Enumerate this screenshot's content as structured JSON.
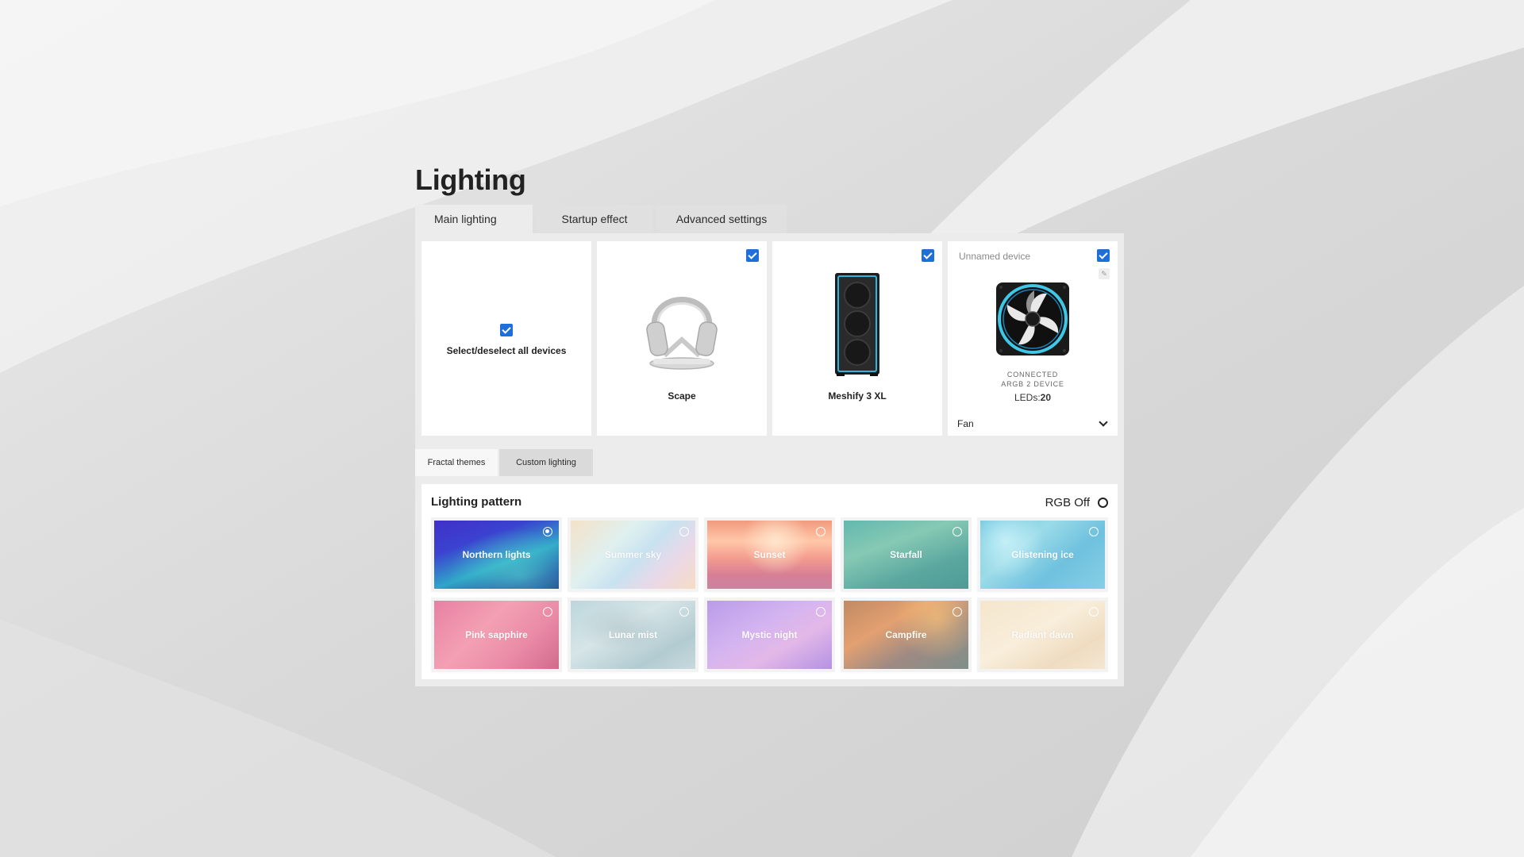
{
  "page": {
    "title": "Lighting"
  },
  "main_tabs": [
    {
      "label": "Main lighting",
      "active": true
    },
    {
      "label": "Startup effect",
      "active": false
    },
    {
      "label": "Advanced settings",
      "active": false
    }
  ],
  "devices": {
    "select_all": {
      "label": "Select/deselect all devices",
      "checked": true
    },
    "items": [
      {
        "name": "Scape",
        "checked": true,
        "icon": "headset-icon"
      },
      {
        "name": "Meshify 3 XL",
        "checked": true,
        "icon": "pc-case-icon"
      },
      {
        "name": "Unnamed device",
        "checked": true,
        "icon": "fan-icon",
        "connected_line1": "Connected",
        "connected_line2": "ARGB 2 device",
        "leds_label": "LEDs:",
        "leds_count": "20",
        "type_value": "Fan"
      }
    ]
  },
  "sub_tabs": [
    {
      "label": "Fractal themes",
      "active": true
    },
    {
      "label": "Custom lighting",
      "active": false
    }
  ],
  "pattern": {
    "title": "Lighting pattern",
    "rgb_off_label": "RGB Off",
    "themes": [
      {
        "label": "Northern lights",
        "selected": true
      },
      {
        "label": "Summer sky",
        "selected": false
      },
      {
        "label": "Sunset",
        "selected": false
      },
      {
        "label": "Starfall",
        "selected": false
      },
      {
        "label": "Glistening ice",
        "selected": false
      },
      {
        "label": "Pink sapphire",
        "selected": false
      },
      {
        "label": "Lunar mist",
        "selected": false
      },
      {
        "label": "Mystic night",
        "selected": false
      },
      {
        "label": "Campfire",
        "selected": false
      },
      {
        "label": "Radiant dawn",
        "selected": false
      }
    ]
  },
  "colors": {
    "accent": "#1e6fd9",
    "panel": "#ececec",
    "card": "#ffffff"
  }
}
